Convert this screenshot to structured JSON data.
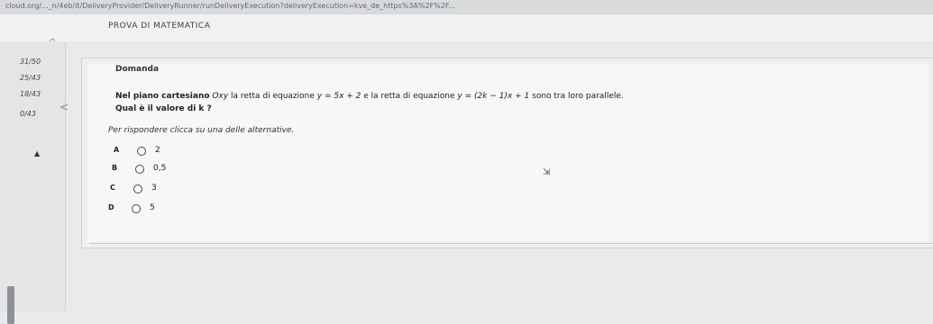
{
  "browser": {
    "url": "cloud.org/..._n/4eb/it/DeliveryProvider/DeliveryRunner/runDeliveryExecution?deliveryExecution=kve_de_https%3A%2F%2F..."
  },
  "exam": {
    "title": "PROVA DI MATEMATICA"
  },
  "sidebar": {
    "items": [
      "31/50",
      "25/43",
      "18/43",
      "0/43"
    ]
  },
  "question": {
    "heading": "Domanda",
    "lead": "Nel piano cartesiano",
    "axes": "Oxy",
    "text1": " la retta di equazione ",
    "eq1": "y = 5x + 2",
    "text2": " e la retta di equazione ",
    "eq2": "y = (2k − 1)x + 1",
    "text3": " sono tra loro parallele.",
    "prompt": "Qual è il valore di k ?",
    "instruction": "Per rispondere clicca su una delle alternative."
  },
  "options": [
    {
      "letter": "A",
      "value": "2"
    },
    {
      "letter": "B",
      "value": "0,5"
    },
    {
      "letter": "C",
      "value": "3"
    },
    {
      "letter": "D",
      "value": "5"
    }
  ]
}
